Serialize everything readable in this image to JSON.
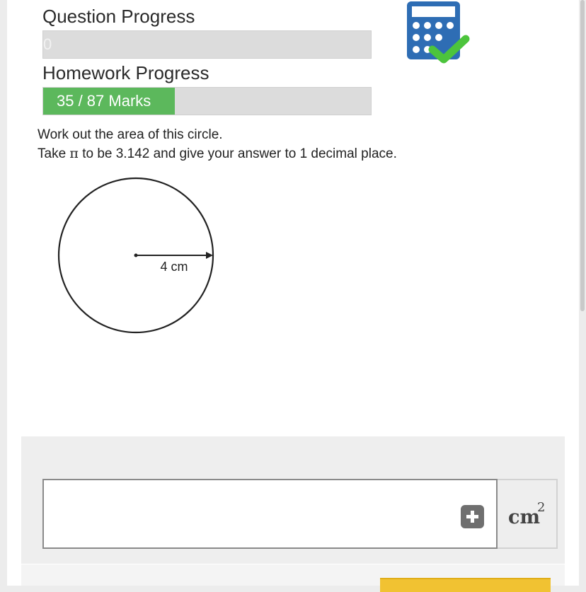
{
  "progress": {
    "question_label": "Question Progress",
    "question_value": "0",
    "question_fraction": 0,
    "homework_label": "Homework Progress",
    "homework_text": "35 / 87 Marks",
    "homework_fraction": 0.402
  },
  "icons": {
    "calculator": "calculator-check-icon",
    "add": "plus-square-icon"
  },
  "question": {
    "line1": "Work out the area of this circle.",
    "line2_prefix": "Take ",
    "pi_symbol": "π",
    "line2_suffix": " to be 3.142 and give your answer to 1 decimal place."
  },
  "diagram": {
    "radius_label": "4 cm"
  },
  "answer": {
    "value": "",
    "unit": "cm",
    "unit_power": "2"
  },
  "colors": {
    "progress_fill": "#5cb85c",
    "calculator_blue": "#2e6db4",
    "check_green": "#4cc43c",
    "submit_yellow": "#f1c232"
  }
}
